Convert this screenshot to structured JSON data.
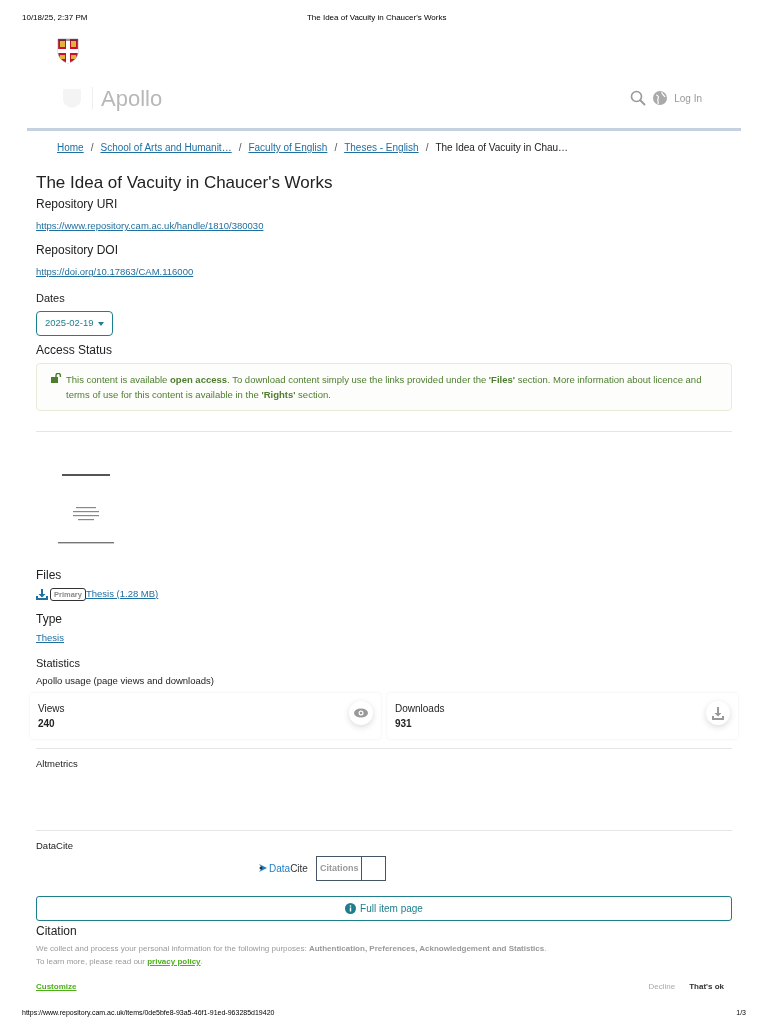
{
  "print_header": {
    "date": "10/18/25, 2:37 PM",
    "title": "The Idea of Vacuity in Chaucer's Works"
  },
  "navbar": {
    "brand": "Apollo",
    "login": "Log In"
  },
  "breadcrumb": [
    {
      "label": "Home",
      "link": true
    },
    {
      "separator": "/",
      "label": "School of Arts and Humanit…",
      "link": true
    },
    {
      "separator": "/",
      "label": "Faculty of English",
      "link": true
    },
    {
      "separator": "/",
      "label": "Theses - English",
      "link": true
    },
    {
      "separator": "/",
      "label": "The Idea of Vacuity in Chau…",
      "link": false
    }
  ],
  "item": {
    "title": "The Idea of Vacuity in Chaucer's Works",
    "uri": {
      "label": "Repository URI",
      "value": "https://www.repository.cam.ac.uk/handle/1810/380030"
    },
    "doi": {
      "label": "Repository DOI",
      "value": "https://doi.org/10.17863/CAM.116000"
    },
    "dates": {
      "label": "Dates",
      "value": "2025-02-19"
    },
    "access": {
      "label": "Access Status",
      "text": "This content is available **open access**. To download content simply use the links provided under the **'Files'** section. More information about licence and terms of use for this content is available in the **'Rights'** section."
    },
    "files": {
      "label": "Files",
      "badge": "Primary",
      "link": "Thesis (1.28 MB)"
    },
    "type": {
      "label": "Type",
      "value": "Thesis"
    },
    "statistics": {
      "label": "Statistics",
      "subtitle": "Apollo usage (page views and downloads)",
      "cards": [
        {
          "kind": "views",
          "label": "Views",
          "value": "240"
        },
        {
          "kind": "downloads",
          "label": "Downloads",
          "value": "931"
        }
      ]
    },
    "altmetrics": {
      "label": "Altmetrics"
    },
    "datacite": {
      "label": "DataCite",
      "logo_a": "Data",
      "logo_b": "Cite",
      "citations": "Citations"
    },
    "full_item_button": "Full item page",
    "citation_label": "Citation"
  },
  "cookie_banner": {
    "text": "We collect and process your personal information for the following purposes: **Authentication, Preferences, Acknowledgement and Statistics**.",
    "learn_prefix": "To learn more, please read our ",
    "privacy_link": "privacy policy",
    "learn_suffix": ".",
    "customize": "Customize",
    "decline": "Decline",
    "accept": "That's ok"
  },
  "print_footer": {
    "url": "https://www.repository.cam.ac.uk/items/0de5bfe8-93a5-46f1-91ed-963285d19420",
    "page": "1/3"
  }
}
